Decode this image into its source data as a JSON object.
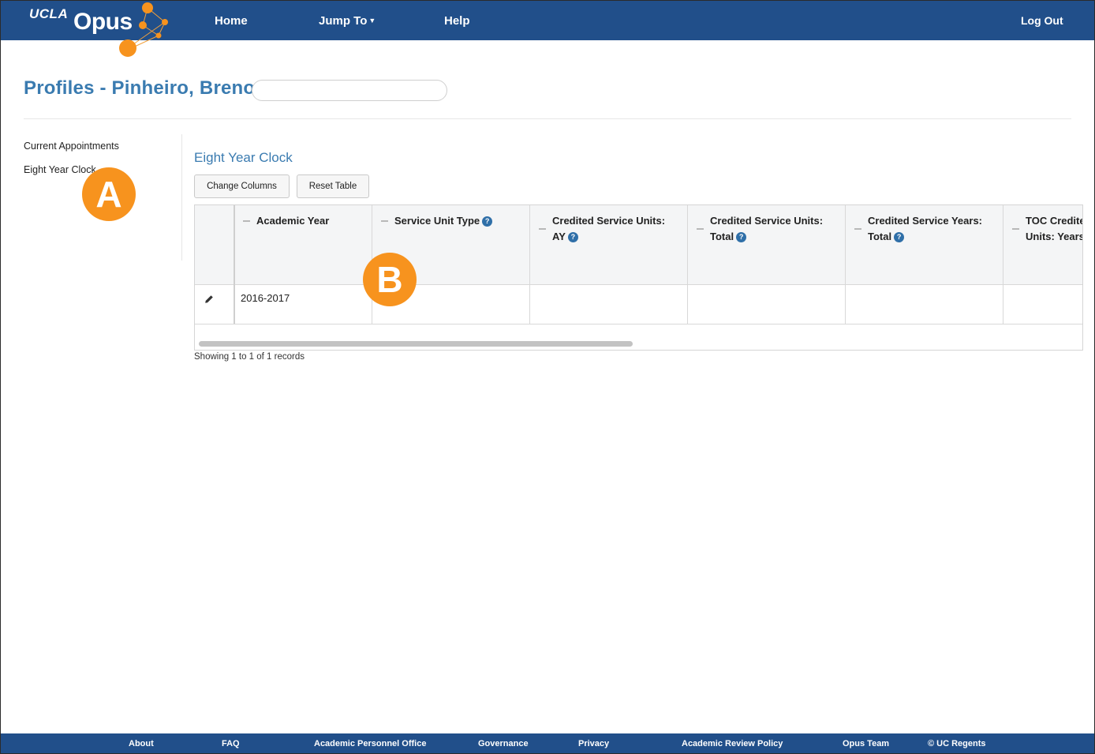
{
  "header": {
    "logo_ucla": "UCLA",
    "logo_opus": "Opus",
    "nav": {
      "home": "Home",
      "jump_to": "Jump To",
      "help": "Help",
      "logout": "Log Out"
    }
  },
  "page": {
    "title": "Profiles - Pinheiro, Breno",
    "search_value": ""
  },
  "sidebar": {
    "items": [
      {
        "label": "Current Appointments"
      },
      {
        "label": "Eight Year Clock"
      }
    ]
  },
  "callouts": {
    "a": "A",
    "b": "B"
  },
  "section": {
    "title": "Eight Year Clock",
    "change_columns": "Change Columns",
    "reset_table": "Reset Table"
  },
  "table": {
    "columns": [
      {
        "line1": "Academic Year",
        "line2": "",
        "help": false
      },
      {
        "line1": "Service Unit Type",
        "line2": "",
        "help": true
      },
      {
        "line1": "Credited Service Units:",
        "line2": "AY",
        "help": true
      },
      {
        "line1": "Credited Service Units:",
        "line2": "Total",
        "help": true
      },
      {
        "line1": "Credited Service Years:",
        "line2": "Total",
        "help": true
      },
      {
        "line1": "TOC Credited",
        "line2": "Units: Years",
        "help": false
      }
    ],
    "rows": [
      {
        "academic_year": "2016-2017",
        "service_unit_type": "",
        "csu_ay": "",
        "csu_total": "",
        "csy_total": "",
        "toc": ""
      }
    ],
    "records_text": "Showing 1 to 1 of 1 records"
  },
  "footer": {
    "links": [
      "About",
      "FAQ",
      "Academic Personnel Office",
      "Governance",
      "Privacy",
      "Academic Review Policy",
      "Opus Team",
      "© UC Regents"
    ]
  },
  "colors": {
    "nav_bg": "#214f8a",
    "accent": "#3a7bb0",
    "callout": "#f7931e",
    "help_icon": "#2f6fa8"
  }
}
